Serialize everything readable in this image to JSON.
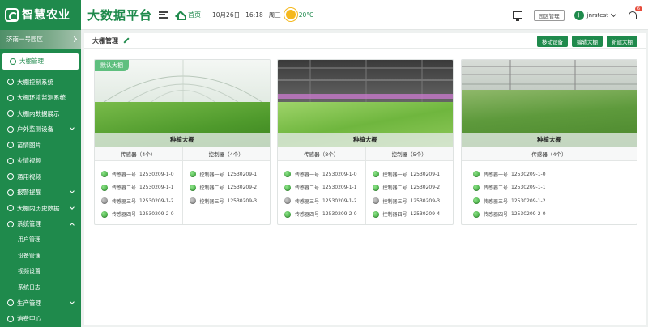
{
  "header": {
    "logo_text": "智慧农业",
    "platform_title": "大数据平台",
    "home_label": "首页",
    "date": "10月26日",
    "time": "16:18",
    "weekday": "周三",
    "temperature": "20°C",
    "park_button": "园区管理",
    "avatar_initial": "J",
    "username": "jnrstest",
    "notification_count": "6"
  },
  "sidebar": {
    "park": "济南一号园区",
    "items": [
      {
        "label": "大棚管理",
        "active": true
      },
      {
        "label": "大棚控制系统"
      },
      {
        "label": "大棚环境监测系统"
      },
      {
        "label": "大棚内数据展示"
      },
      {
        "label": "户外监测设备"
      },
      {
        "label": "苗情图片"
      },
      {
        "label": "灾情视频"
      },
      {
        "label": "通用视频"
      },
      {
        "label": "报警提醒"
      },
      {
        "label": "大棚内历史数据"
      },
      {
        "label": "系统管理"
      },
      {
        "label": "用户管理"
      },
      {
        "label": "设备管理"
      },
      {
        "label": "视频设置"
      },
      {
        "label": "系统日志"
      },
      {
        "label": "生产管理"
      },
      {
        "label": "消费中心"
      }
    ]
  },
  "main": {
    "title": "大棚管理",
    "buttons": {
      "move": "移动设备",
      "edit": "编辑大棚",
      "create": "新建大棚"
    },
    "cards": [
      {
        "tag": "默认大棚",
        "name": "种植大棚",
        "sensor_header": "传感器（4个）",
        "controller_header": "控制器（4个）",
        "sensors": [
          {
            "name": "传感器一号",
            "code": "12530209-1-0",
            "on": true
          },
          {
            "name": "传感器二号",
            "code": "12530209-1-1",
            "on": true
          },
          {
            "name": "传感器三号",
            "code": "12530209-1-2",
            "on": false
          },
          {
            "name": "传感器四号",
            "code": "12530209-2-0",
            "on": true
          }
        ],
        "controllers": [
          {
            "name": "控制器一号",
            "code": "12530209-1",
            "on": true
          },
          {
            "name": "控制器二号",
            "code": "12530209-2",
            "on": true
          },
          {
            "name": "控制器三号",
            "code": "12530209-3",
            "on": false
          }
        ]
      },
      {
        "name": "种植大棚",
        "sensor_header": "传感器（8个）",
        "controller_header": "控制器（5个）",
        "sensors": [
          {
            "name": "传感器一号",
            "code": "12530209-1-0",
            "on": true
          },
          {
            "name": "传感器二号",
            "code": "12530209-1-1",
            "on": true
          },
          {
            "name": "传感器三号",
            "code": "12530209-1-2",
            "on": false
          },
          {
            "name": "传感器四号",
            "code": "12530209-2-0",
            "on": true
          }
        ],
        "controllers": [
          {
            "name": "控制器一号",
            "code": "12530209-1",
            "on": true
          },
          {
            "name": "控制器二号",
            "code": "12530209-2",
            "on": true
          },
          {
            "name": "控制器三号",
            "code": "12530209-3",
            "on": false
          },
          {
            "name": "控制器四号",
            "code": "12530209-4",
            "on": true
          }
        ]
      },
      {
        "name": "种植大棚",
        "sensor_header": "传感器（4个）",
        "sensors": [
          {
            "name": "传感器一号",
            "code": "12530209-1-0",
            "on": true
          },
          {
            "name": "传感器二号",
            "code": "12530209-1-1",
            "on": true
          },
          {
            "name": "传感器三号",
            "code": "12530209-1-2",
            "on": true
          },
          {
            "name": "传感器四号",
            "code": "12530209-2-0",
            "on": true
          }
        ]
      }
    ]
  },
  "colors": {
    "brand": "#1f8a4c",
    "on": "#3cb043",
    "off": "#9a9a9a"
  }
}
